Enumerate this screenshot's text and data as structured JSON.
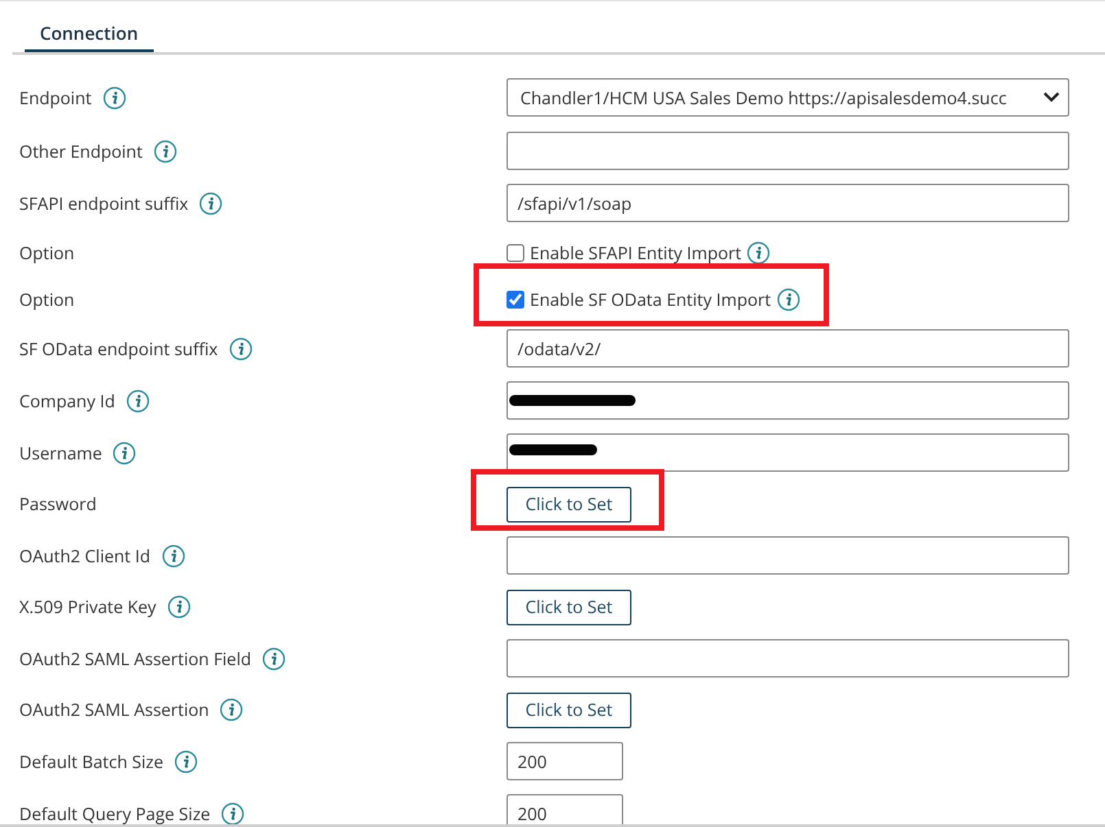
{
  "tabs": [
    {
      "label": "Connection",
      "selected": true
    }
  ],
  "rows": [
    {
      "label": "Endpoint",
      "info": true,
      "kind": "select",
      "value": "Chandler1/HCM USA Sales Demo https://apisalesdemo4.succ"
    },
    {
      "label": "Other Endpoint",
      "info": true,
      "kind": "text"
    },
    {
      "label": "SFAPI endpoint suffix",
      "info": true,
      "kind": "text",
      "value": "/sfapi/v1/soap"
    },
    {
      "label": "Option",
      "info": false,
      "kind": "checkbox",
      "option": "Enable SFAPI Entity Import",
      "checked": false,
      "highlighted": false
    },
    {
      "label": "Option",
      "info": false,
      "kind": "checkbox",
      "option": "Enable SF OData Entity Import",
      "checked": true,
      "highlighted": true
    },
    {
      "label": "SF OData endpoint suffix",
      "info": true,
      "kind": "text",
      "value": "/odata/v2/"
    },
    {
      "label": "Company Id",
      "info": true,
      "kind": "text",
      "redacted": true
    },
    {
      "label": "Username",
      "info": true,
      "kind": "text",
      "redacted": true
    },
    {
      "label": "Password",
      "info": false,
      "kind": "button",
      "button": "Click to Set",
      "highlighted": true
    },
    {
      "label": "OAuth2 Client Id",
      "info": true,
      "kind": "text"
    },
    {
      "label": "X.509 Private Key",
      "info": true,
      "kind": "button",
      "button": "Click to Set",
      "highlighted": false
    },
    {
      "label": "OAuth2 SAML Assertion Field",
      "info": true,
      "kind": "text"
    },
    {
      "label": "OAuth2 SAML Assertion",
      "info": true,
      "kind": "button",
      "button": "Click to Set",
      "highlighted": false
    },
    {
      "label": "Default Batch Size",
      "info": true,
      "kind": "small",
      "value": "200"
    },
    {
      "label": "Default Query Page Size",
      "info": true,
      "kind": "small",
      "value": "200"
    }
  ]
}
